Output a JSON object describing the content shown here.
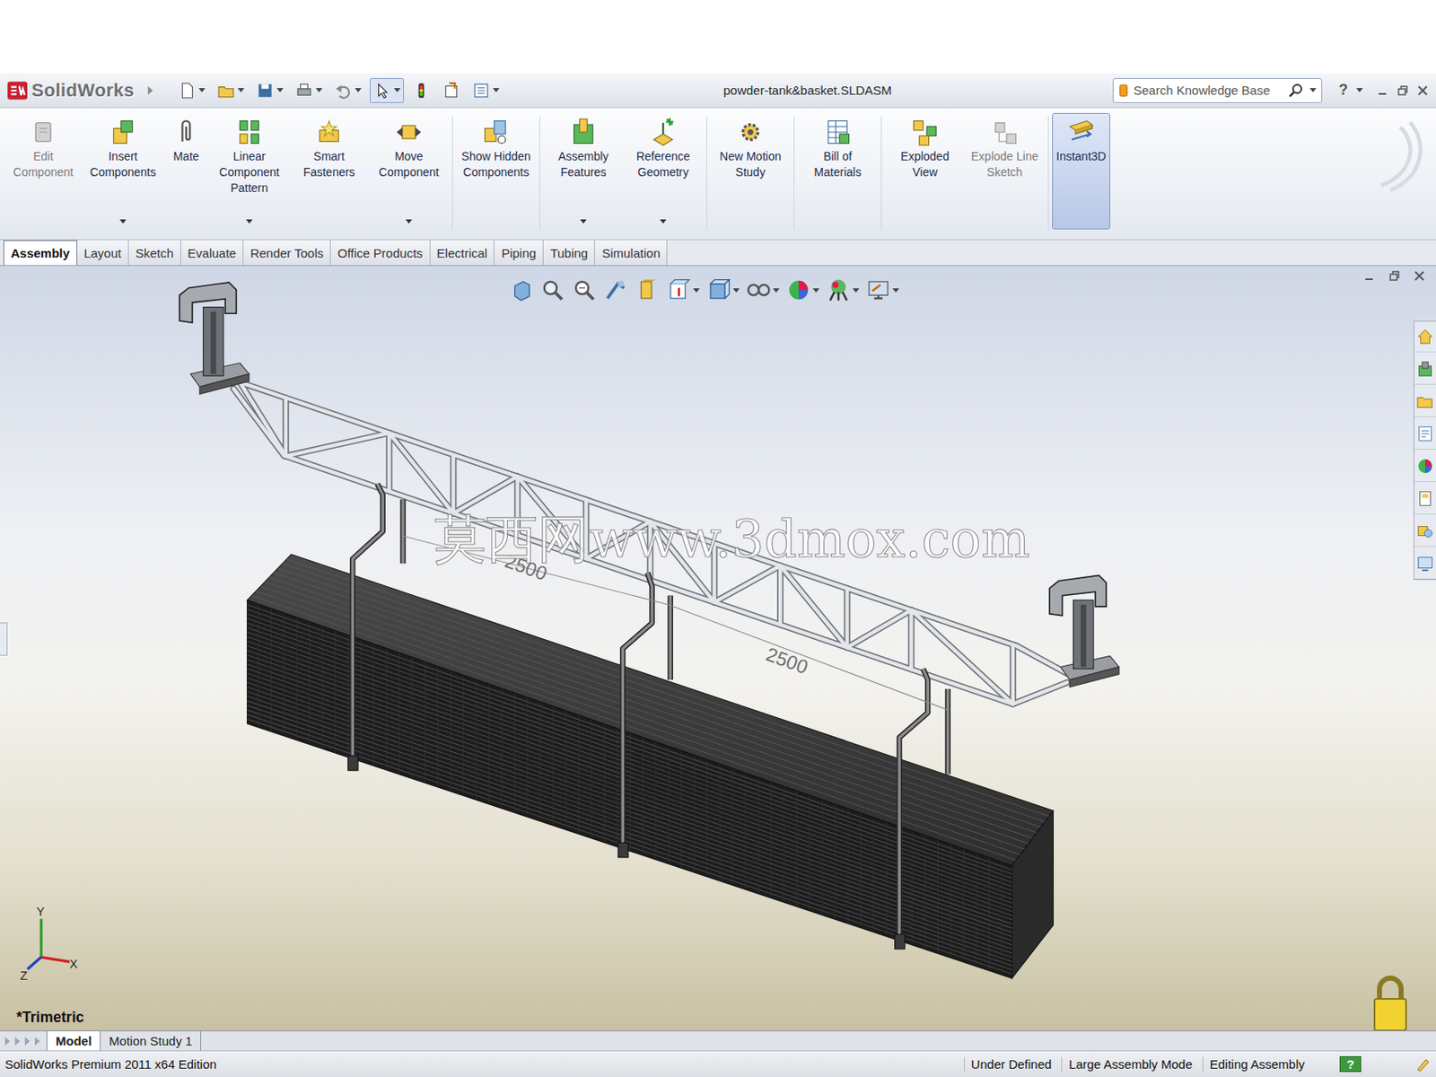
{
  "window": {
    "title": "powder-tank&basket.SLDASM",
    "logo": "SolidWorks"
  },
  "search": {
    "placeholder": "Search Knowledge Base"
  },
  "help": "?",
  "command_manager": [
    {
      "label": "Edit Component",
      "disabled": true,
      "dropdown": false,
      "selected": false
    },
    {
      "label": "Insert Components",
      "disabled": false,
      "dropdown": true,
      "selected": false
    },
    {
      "label": "Mate",
      "disabled": false,
      "dropdown": false,
      "selected": false
    },
    {
      "label": "Linear Component Pattern",
      "disabled": false,
      "dropdown": true,
      "selected": false
    },
    {
      "label": "Smart Fasteners",
      "disabled": false,
      "dropdown": false,
      "selected": false
    },
    {
      "label": "Move Component",
      "disabled": false,
      "dropdown": true,
      "selected": false
    },
    {
      "label": "Show Hidden Components",
      "disabled": false,
      "dropdown": false,
      "selected": false
    },
    {
      "label": "Assembly Features",
      "disabled": false,
      "dropdown": true,
      "selected": false
    },
    {
      "label": "Reference Geometry",
      "disabled": false,
      "dropdown": true,
      "selected": false
    },
    {
      "label": "New Motion Study",
      "disabled": false,
      "dropdown": false,
      "selected": false
    },
    {
      "label": "Bill of Materials",
      "disabled": false,
      "dropdown": false,
      "selected": false
    },
    {
      "label": "Exploded View",
      "disabled": false,
      "dropdown": false,
      "selected": false
    },
    {
      "label": "Explode Line Sketch",
      "disabled": true,
      "dropdown": false,
      "selected": false
    },
    {
      "label": "Instant3D",
      "disabled": false,
      "dropdown": false,
      "selected": true
    }
  ],
  "tabs": [
    {
      "label": "Assembly",
      "selected": true
    },
    {
      "label": "Layout",
      "selected": false
    },
    {
      "label": "Sketch",
      "selected": false
    },
    {
      "label": "Evaluate",
      "selected": false
    },
    {
      "label": "Render Tools",
      "selected": false
    },
    {
      "label": "Office Products",
      "selected": false
    },
    {
      "label": "Electrical",
      "selected": false
    },
    {
      "label": "Piping",
      "selected": false
    },
    {
      "label": "Tubing",
      "selected": false
    },
    {
      "label": "Simulation",
      "selected": false
    }
  ],
  "viewport": {
    "watermark": "莫西网www.3dmox.com",
    "dimensions": [
      "2500",
      "2500"
    ],
    "axes": {
      "x": "X",
      "y": "Y",
      "z": "Z"
    },
    "view": "*Trimetric"
  },
  "bottom_tabs": [
    {
      "label": "Model",
      "selected": true
    },
    {
      "label": "Motion Study 1",
      "selected": false
    }
  ],
  "status_bar": {
    "edition": "SolidWorks Premium 2011 x64 Edition",
    "items": [
      "Under Defined",
      "Large Assembly Mode",
      "Editing Assembly"
    ],
    "help": "?"
  }
}
